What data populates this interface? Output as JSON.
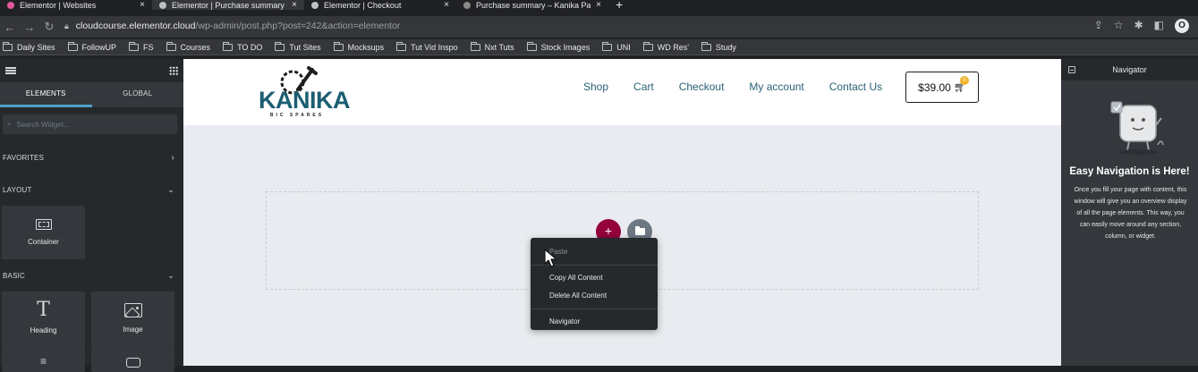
{
  "browser": {
    "tabs": [
      {
        "label": "Elementor | Websites",
        "active": false,
        "favicon_color": "#e0589b"
      },
      {
        "label": "Elementor | Purchase summary",
        "active": true,
        "favicon_color": "#bdc1c6"
      },
      {
        "label": "Elementor | Checkout",
        "active": false,
        "favicon_color": "#bdc1c6"
      },
      {
        "label": "Purchase summary – Kanika Pa",
        "active": false,
        "favicon_color": "#8a8a8a"
      }
    ],
    "new_tab": "+",
    "url_host": "cloudcourse.elementor.cloud",
    "url_path": "/wp-admin/post.php?post=242&action=elementor",
    "profile_letter": "O"
  },
  "bookmarks": [
    "Daily Sites",
    "FollowUP",
    "FS",
    "Courses",
    "TO DO",
    "Tut Sites",
    "Mocksups",
    "Tut Vid Inspo",
    "Nxt Tuts",
    "Stock Images",
    "UNI",
    "WD Res'",
    "Study"
  ],
  "panel": {
    "tabs": [
      "ELEMENTS",
      "GLOBAL"
    ],
    "search_placeholder": "Search Widget...",
    "sections": {
      "favorites": "FAVORITES",
      "layout": "LAYOUT",
      "basic": "BASIC"
    },
    "widgets": {
      "container": "Container",
      "heading": "Heading",
      "image": "Image"
    }
  },
  "site": {
    "logo_text": "KANIKA",
    "logo_sub": "BIC SPARES",
    "menu": [
      "Shop",
      "Cart",
      "Checkout",
      "My account",
      "Contact Us"
    ],
    "cart_total": "$39.00",
    "cart_count": "0"
  },
  "context_menu": {
    "paste": "Paste",
    "copy_all": "Copy All Content",
    "delete_all": "Delete All Content",
    "navigator": "Navigator"
  },
  "navigator": {
    "title": "Navigator",
    "heading": "Easy Navigation is Here!",
    "description": "Once you fill your page with content, this window will give you an overview display of all the page elements. This way, you can easily move around any section, column, or widget."
  },
  "colors": {
    "accent_pink": "#93003c",
    "elementor_tab": "#4fa0c7",
    "site_teal": "#2a6076"
  }
}
